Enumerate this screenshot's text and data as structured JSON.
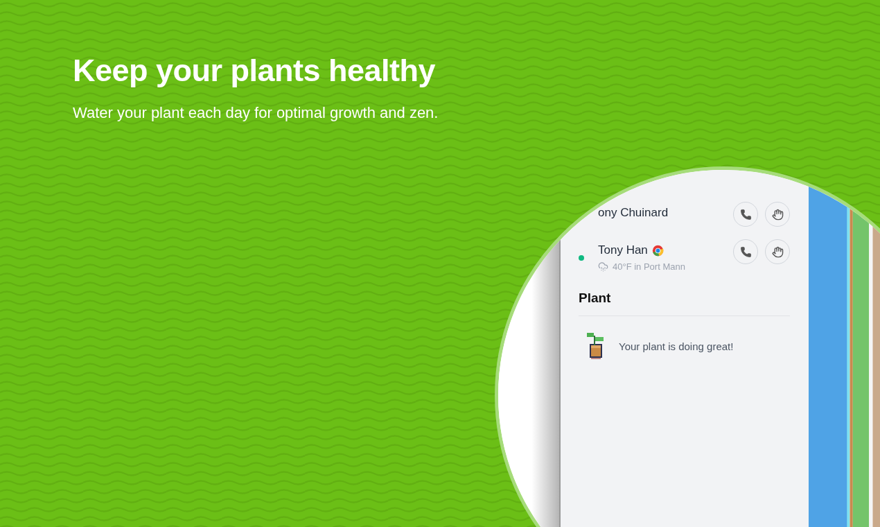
{
  "headline": "Keep your plants healthy",
  "subtitle": "Water your plant each day for optimal growth and zen.",
  "people": [
    {
      "name": "ony Chuinard",
      "online": false,
      "browser_icon": false
    },
    {
      "name": "Tony Han",
      "online": true,
      "browser_icon": true,
      "status": "40°F in Port Mann"
    }
  ],
  "plant": {
    "title": "Plant",
    "message": "Your plant is doing great!"
  }
}
